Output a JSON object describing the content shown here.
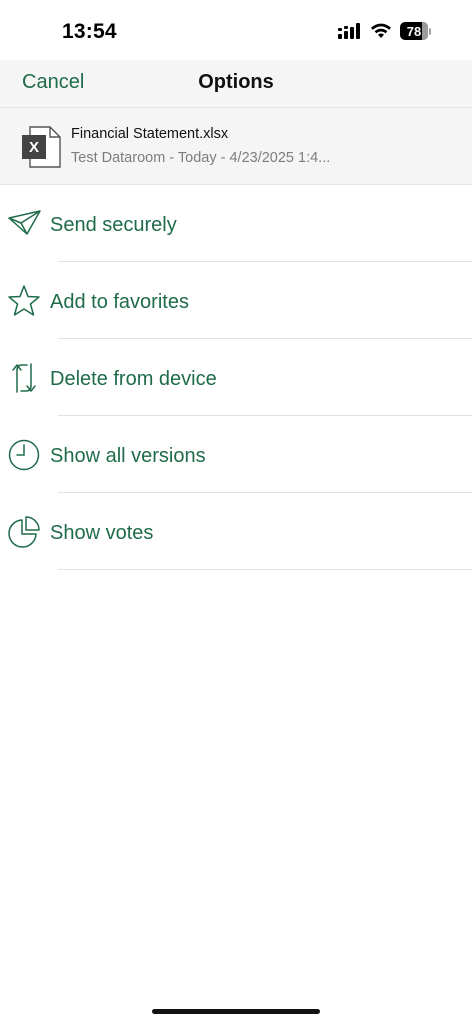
{
  "status_bar": {
    "time": "13:54",
    "battery": "78",
    "icons": [
      "signal-icon",
      "wifi-icon",
      "battery-icon"
    ]
  },
  "nav": {
    "cancel_label": "Cancel",
    "title": "Options"
  },
  "file": {
    "name": "Financial Statement.xlsx",
    "meta": "Test Dataroom - Today - 4/23/2025 1:4...",
    "icon": "excel-file-icon"
  },
  "options": [
    {
      "label": "Send securely",
      "icon": "paper-plane-icon"
    },
    {
      "label": "Add to favorites",
      "icon": "star-icon"
    },
    {
      "label": "Delete from device",
      "icon": "sync-arrows-icon"
    },
    {
      "label": "Show all versions",
      "icon": "clock-icon"
    },
    {
      "label": "Show votes",
      "icon": "pie-chart-icon"
    }
  ],
  "colors": {
    "accent": "#1f6b4a",
    "nav_background": "#f5f5f5",
    "secondary_text": "#7d7d7d"
  }
}
